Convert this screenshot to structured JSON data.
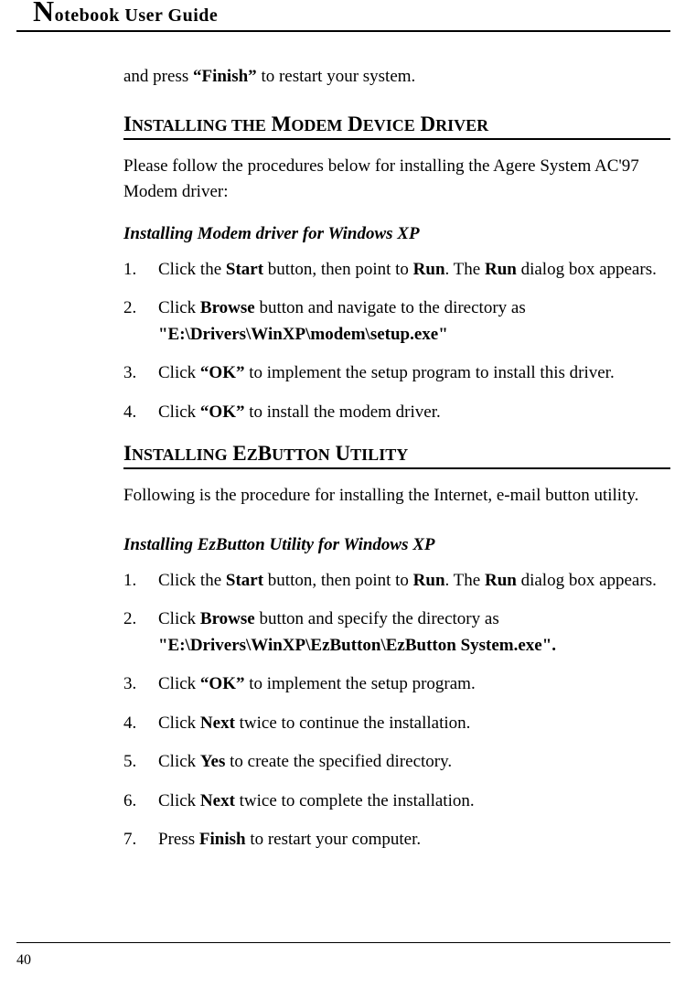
{
  "header": {
    "title_dropcap": "N",
    "title_rest": "otebook User Guide"
  },
  "continuation": {
    "pre": "and press ",
    "bold": "“Finish”",
    "post": " to restart your system."
  },
  "section1": {
    "heading": "Installing the Modem Device Driver",
    "intro": "Please follow the procedures below for installing the Agere System AC'97 Modem driver:",
    "subheading": "Installing Modem driver for Windows XP",
    "steps": [
      {
        "num": "1.",
        "parts": [
          {
            "t": "Click the "
          },
          {
            "t": "Start",
            "b": true
          },
          {
            "t": " button, then point to "
          },
          {
            "t": "Run",
            "b": true
          },
          {
            "t": ". The "
          },
          {
            "t": "Run",
            "b": true
          },
          {
            "t": " dialog box appears."
          }
        ]
      },
      {
        "num": "2.",
        "parts": [
          {
            "t": "Click "
          },
          {
            "t": "Browse",
            "b": true
          },
          {
            "t": " button and navigate to the directory as "
          },
          {
            "t": "\"E:\\Drivers\\WinXP\\modem\\setup.exe\"",
            "b": true
          }
        ]
      },
      {
        "num": "3.",
        "parts": [
          {
            "t": "Click "
          },
          {
            "t": "“OK”",
            "b": true
          },
          {
            "t": " to implement the setup program to install this driver."
          }
        ]
      },
      {
        "num": "4.",
        "parts": [
          {
            "t": "Click "
          },
          {
            "t": "“OK”",
            "b": true
          },
          {
            "t": " to install the modem driver."
          }
        ]
      }
    ]
  },
  "section2": {
    "heading": "Installing EzButton Utility",
    "intro": "Following is the procedure for installing the Internet, e-mail button utility.",
    "subheading": "Installing EzButton Utility for Windows XP",
    "steps": [
      {
        "num": "1.",
        "parts": [
          {
            "t": "Click the "
          },
          {
            "t": "Start",
            "b": true
          },
          {
            "t": " button, then point to "
          },
          {
            "t": "Run",
            "b": true
          },
          {
            "t": ". The "
          },
          {
            "t": "Run",
            "b": true
          },
          {
            "t": " dialog box appears."
          }
        ]
      },
      {
        "num": "2.",
        "parts": [
          {
            "t": "Click "
          },
          {
            "t": "Browse",
            "b": true
          },
          {
            "t": " button and specify the directory as "
          },
          {
            "t": "\"E:\\Drivers\\WinXP\\EzButton\\EzButton System.exe\".",
            "b": true
          }
        ]
      },
      {
        "num": "3.",
        "parts": [
          {
            "t": "Click "
          },
          {
            "t": "“OK”",
            "b": true
          },
          {
            "t": " to implement the setup program."
          }
        ]
      },
      {
        "num": "4.",
        "parts": [
          {
            "t": "Click "
          },
          {
            "t": "Next",
            "b": true
          },
          {
            "t": " twice to continue the installation."
          }
        ]
      },
      {
        "num": "5.",
        "parts": [
          {
            "t": "Click "
          },
          {
            "t": "Yes",
            "b": true
          },
          {
            "t": " to create the specified directory."
          }
        ]
      },
      {
        "num": "6.",
        "parts": [
          {
            "t": "Click "
          },
          {
            "t": "Next",
            "b": true
          },
          {
            "t": " twice to complete the installation."
          }
        ]
      },
      {
        "num": "7.",
        "parts": [
          {
            "t": "Press "
          },
          {
            "t": "Finish",
            "b": true
          },
          {
            "t": " to restart your computer."
          }
        ]
      }
    ]
  },
  "footer": {
    "page_number": "40"
  }
}
